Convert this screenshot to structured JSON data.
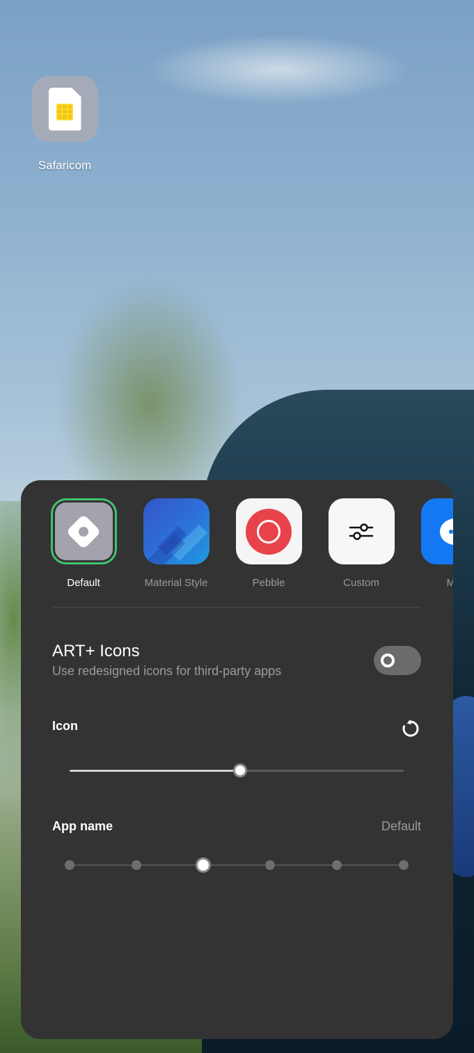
{
  "home_app": {
    "label": "Safaricom",
    "icon": "sim-card-icon"
  },
  "icon_styles": [
    {
      "name": "Default",
      "icon": "default-style-icon",
      "selected": true
    },
    {
      "name": "Material Style",
      "icon": "material-style-icon",
      "selected": false
    },
    {
      "name": "Pebble",
      "icon": "pebble-style-icon",
      "selected": false
    },
    {
      "name": "Custom",
      "icon": "sliders-icon",
      "selected": false
    },
    {
      "name": "Me",
      "icon": "message-icon",
      "selected": false
    }
  ],
  "art_plus": {
    "title": "ART+ Icons",
    "description": "Use redesigned icons for third-party apps",
    "enabled": false
  },
  "icon_size": {
    "label": "Icon",
    "reset_icon": "reset-icon",
    "value_fraction": 0.51
  },
  "app_name": {
    "label": "App name",
    "value": "Default",
    "steps": 6,
    "selected_step": 2
  },
  "colors": {
    "panel": "#333333",
    "selection_ring": "#3ec46d",
    "pebble_red": "#e8434a",
    "material_blue": "#2d6fd8"
  }
}
